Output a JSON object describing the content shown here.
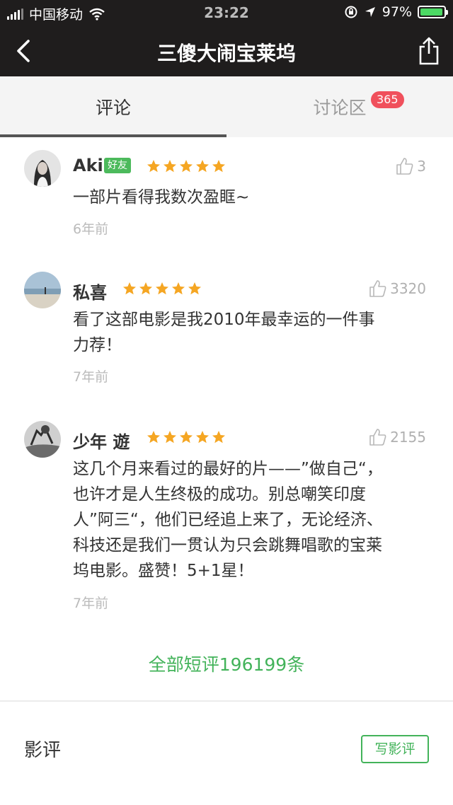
{
  "status_bar": {
    "carrier": "中国移动",
    "time": "23:22",
    "battery_text": "97%",
    "battery_level": 0.97,
    "icons": [
      "signal-icon",
      "wifi-icon",
      "rotation-lock-icon",
      "location-icon",
      "battery-icon"
    ]
  },
  "nav": {
    "title": "三傻大闹宝莱坞",
    "back_icon": "back-chevron-icon",
    "share_icon": "share-icon"
  },
  "tabs": [
    {
      "label": "评论",
      "active": true
    },
    {
      "label": "讨论区",
      "badge": "365",
      "active": false
    }
  ],
  "comments": [
    {
      "name": "Aki",
      "tag": "好友",
      "rating": 5,
      "likes": "3",
      "text_lines": [
        "一部片看得我数次盈眶~"
      ],
      "time": "6年前"
    },
    {
      "name": "私喜",
      "rating": 5,
      "likes": "3320",
      "text_lines": [
        "看了这部电影是我2010年最幸运的一件事",
        "力荐！"
      ],
      "time": "7年前"
    },
    {
      "name": "少年 遊",
      "rating": 5,
      "likes": "2155",
      "text_lines": [
        "这几个月来看过的最好的片——”做自己“，",
        "也许才是人生终极的成功。别总嘲笑印度",
        "人”阿三“，他们已经追上来了，无论经济、",
        "科技还是我们一贯认为只会跳舞唱歌的宝莱",
        "坞电影。盛赞！5+1星！"
      ],
      "time": "7年前"
    }
  ],
  "more_link": "全部短评196199条",
  "review_section": {
    "title": "影评",
    "write_button": "写影评"
  },
  "colors": {
    "topbar": "#1f1d1d",
    "accent_green": "#43b35a",
    "star": "#f5a623",
    "badge": "#f0505c"
  }
}
